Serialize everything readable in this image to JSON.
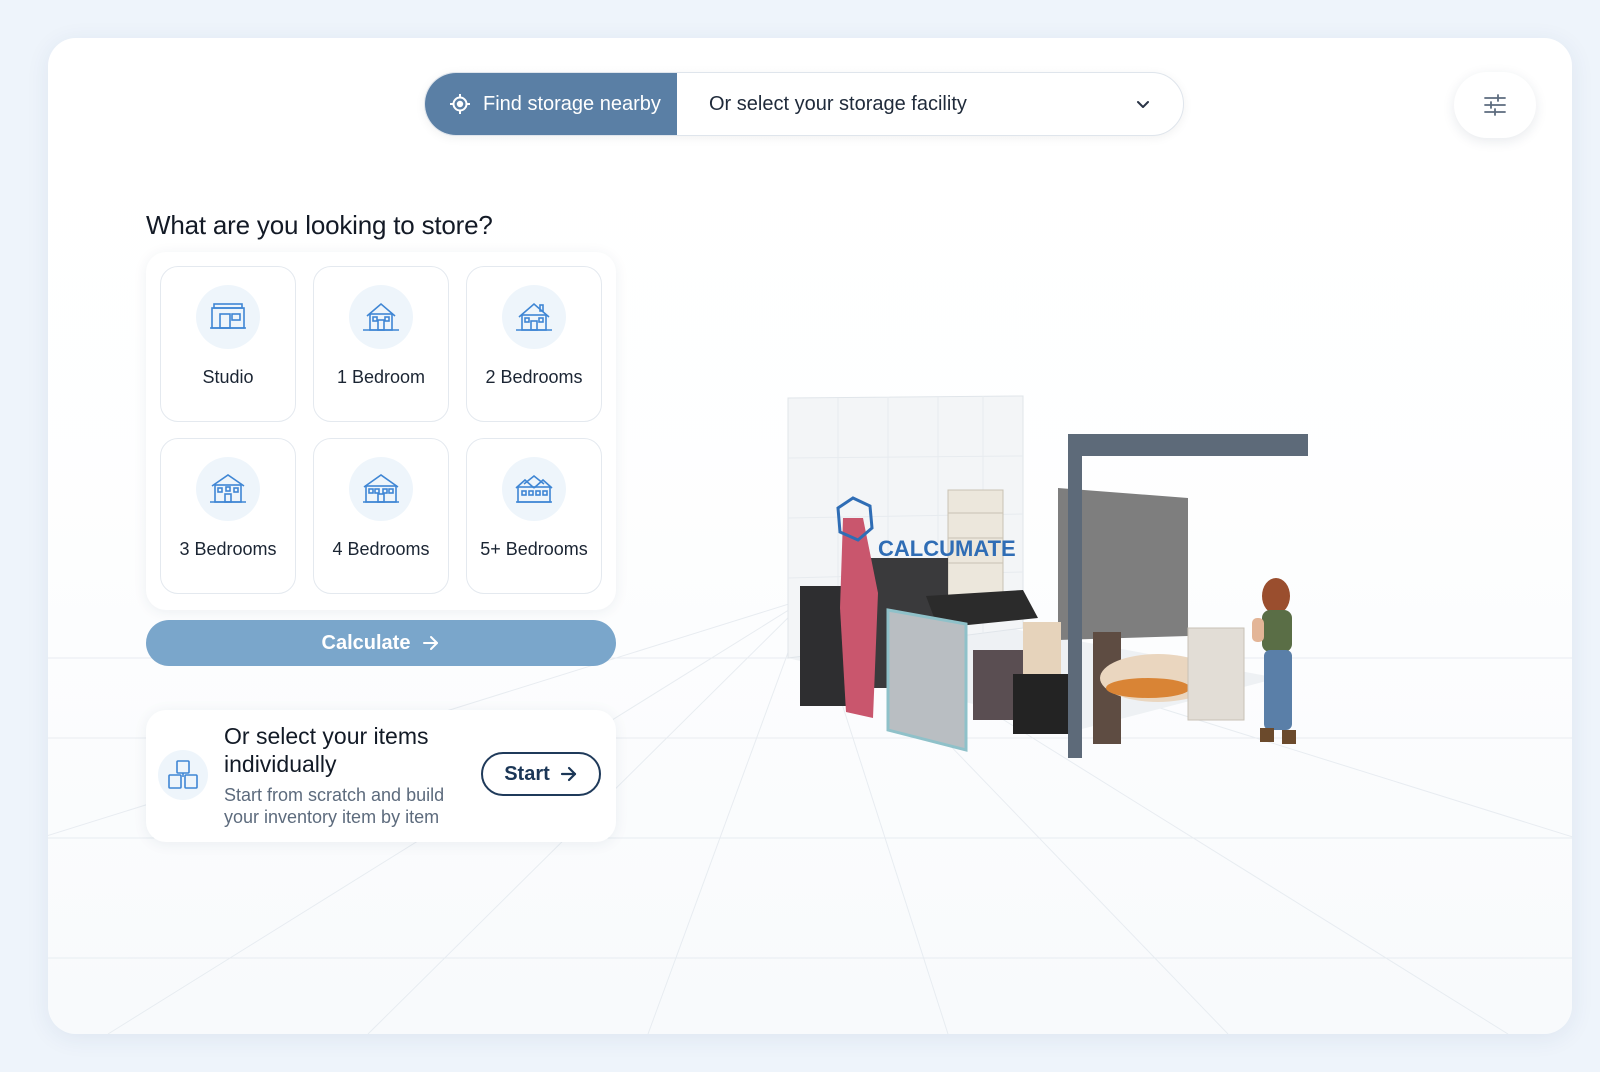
{
  "topbar": {
    "find_label": "Find storage nearby",
    "facility_placeholder": "Or select your storage facility"
  },
  "main": {
    "heading": "What are you looking to store?",
    "tiles": [
      {
        "label": "Studio",
        "icon": "studio-icon"
      },
      {
        "label": "1 Bedroom",
        "icon": "house-1-bedroom-icon"
      },
      {
        "label": "2 Bedrooms",
        "icon": "house-2-bedrooms-icon"
      },
      {
        "label": "3 Bedrooms",
        "icon": "house-3-bedrooms-icon"
      },
      {
        "label": "4 Bedrooms",
        "icon": "house-4-bedrooms-icon"
      },
      {
        "label": "5+ Bedrooms",
        "icon": "house-5-bedrooms-icon"
      }
    ],
    "calculate_label": "Calculate",
    "items": {
      "title": "Or select your items individually",
      "subtitle": "Start from scratch and build your inventory item by item",
      "start_label": "Start"
    }
  },
  "scene": {
    "brand_text": "CALCUMATE"
  },
  "colors": {
    "accent": "#5a7fa5",
    "calculate": "#7aa6cb",
    "dark_navy": "#1f3a5a",
    "icon_bg": "#eef5fb",
    "icon_stroke": "#3f86d4"
  }
}
